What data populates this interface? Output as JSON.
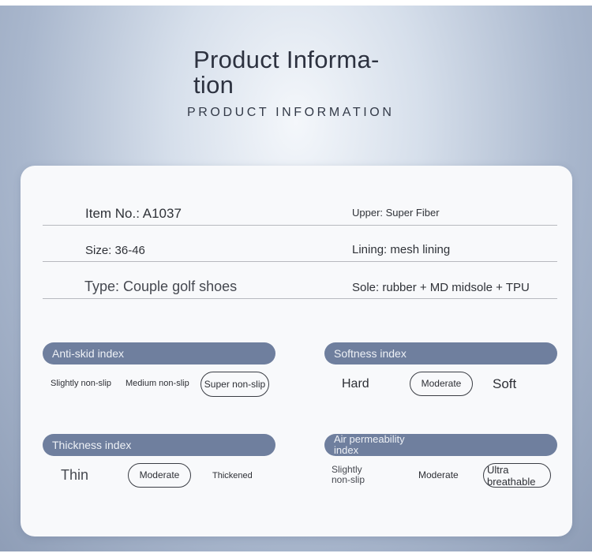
{
  "header": {
    "title": "Product Informa-\ntion",
    "subtitle": "PRODUCT INFORMATION"
  },
  "specs": {
    "item_no": "Item No.: A1037",
    "upper": "Upper: Super Fiber",
    "size": "Size: 36-46",
    "lining": "Lining: mesh lining",
    "type": "Type: Couple golf shoes",
    "sole": "Sole: rubber + MD midsole + TPU"
  },
  "indices": {
    "anti_skid": {
      "label": "Anti-skid index",
      "options": [
        "Slightly non-slip",
        "Medium non-slip",
        "Super non-slip"
      ],
      "selected": "Super non-slip"
    },
    "softness": {
      "label": "Softness index",
      "options": [
        "Hard",
        "Moderate",
        "Soft"
      ],
      "selected": "Moderate"
    },
    "thickness": {
      "label": "Thickness index",
      "options": [
        "Thin",
        "Moderate",
        "Thickened"
      ],
      "selected": "Moderate"
    },
    "air_permeability": {
      "label": "Air permeability\nindex",
      "options": [
        "Slightly\nnon-slip",
        "Moderate",
        "Ultra\nbreathable"
      ],
      "selected": "Ultra breathable"
    }
  },
  "colors": {
    "header_bar": "#6f7f9e",
    "card": "#f8f9fb",
    "text": "#2f3238"
  }
}
